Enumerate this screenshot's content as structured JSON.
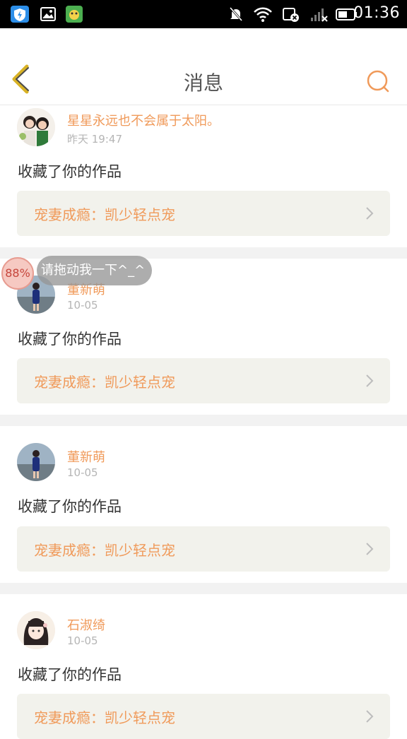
{
  "status_bar": {
    "time": "01:36"
  },
  "header": {
    "title": "消息"
  },
  "messages": [
    {
      "username": "星星永远也不会属于太阳。",
      "time": "昨天 19:47",
      "action": "收藏了你的作品",
      "work_title": "宠妻成瘾：凯少轻点宠"
    },
    {
      "username": "董新萌",
      "time": "10-05",
      "action": "收藏了你的作品",
      "work_title": "宠妻成瘾：凯少轻点宠"
    },
    {
      "username": "董新萌",
      "time": "10-05",
      "action": "收藏了你的作品",
      "work_title": "宠妻成瘾：凯少轻点宠"
    },
    {
      "username": "石淑绮",
      "time": "10-05",
      "action": "收藏了你的作品",
      "work_title": "宠妻成瘾：凯少轻点宠"
    }
  ],
  "floating_widget": {
    "percent": "88%",
    "tip": "请拖动我一下^_^"
  },
  "colors": {
    "accent": "#f09a5a",
    "background": "#ffffff",
    "divider": "#f2f2f2",
    "work_box": "#f2f2ec"
  }
}
